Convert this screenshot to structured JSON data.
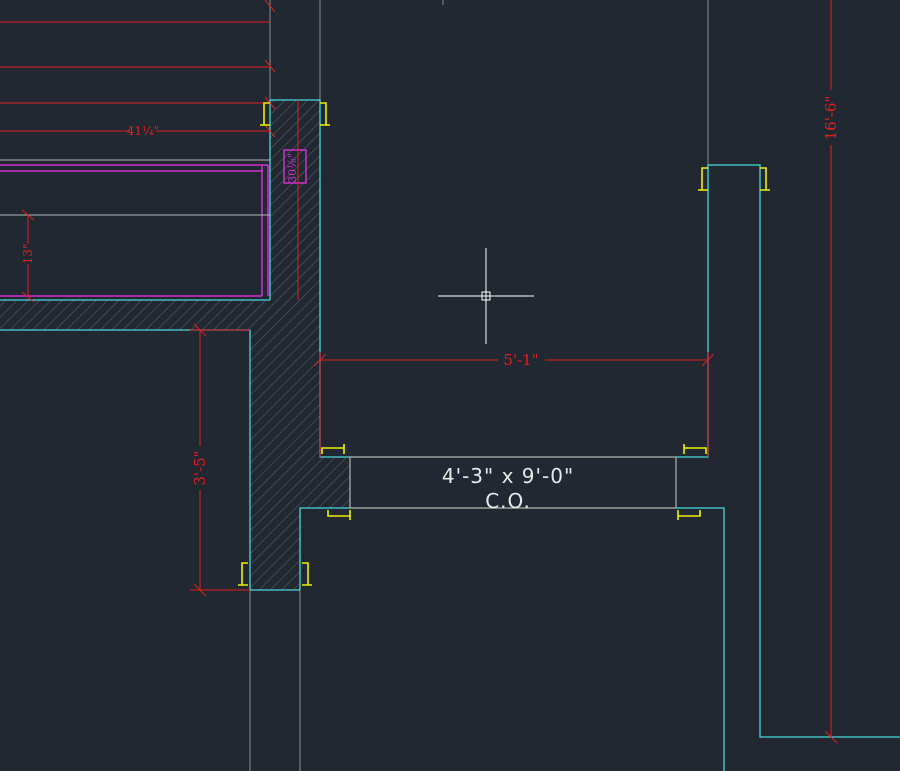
{
  "drawing": {
    "colors": {
      "background": "#222831",
      "wall": "#47d7dd",
      "opening_line": "#b4b4b4",
      "dimension": "#e02020",
      "fixture": "#d030d0",
      "corner_mark": "#f0f000",
      "hatch": "#555b63",
      "crosshair": "#ffffff"
    },
    "dimensions": {
      "width_5_1": "5'-1\"",
      "height_3_5": "3'-5\"",
      "height_16_6": "16'-6\"",
      "width_41_quarter": "41¼\"",
      "height_13": "13\"",
      "fixture_30": "30⅛\""
    },
    "opening": {
      "size": "4'-3\" x 9'-0\"",
      "type": "C.O."
    }
  }
}
